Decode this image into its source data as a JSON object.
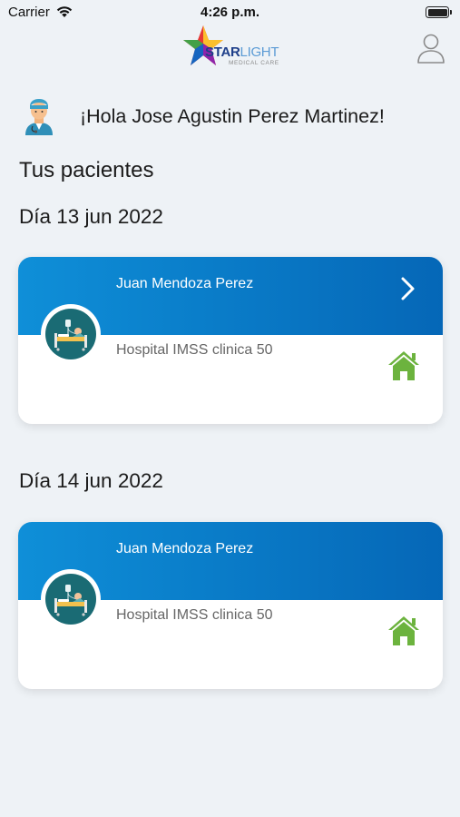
{
  "status_bar": {
    "carrier": "Carrier",
    "time": "4:26 p.m."
  },
  "header": {
    "logo": {
      "star": "STAR",
      "light": "LIGHT",
      "subtitle": "MEDICAL CARE"
    },
    "profile_icon": "person-outline-icon"
  },
  "greeting": {
    "text": "¡Hola Jose Agustin Perez Martinez!",
    "avatar_icon": "doctor-avatar-icon"
  },
  "section_title": "Tus pacientes",
  "days": [
    {
      "label": "Día 13 jun 2022",
      "card": {
        "patient_name": "Juan Mendoza Perez",
        "hospital": "Hospital IMSS clinica 50",
        "has_chevron": true,
        "home_icon": "home-icon"
      }
    },
    {
      "label": "Día 14 jun 2022",
      "card": {
        "patient_name": "Juan Mendoza Perez",
        "hospital": "Hospital IMSS clinica 50",
        "has_chevron": false,
        "home_icon": "home-icon"
      }
    }
  ],
  "colors": {
    "background": "#eef2f6",
    "card_band_start": "#0f8fd8",
    "card_band_end": "#0567b7",
    "home_icon": "#6cb33e",
    "avatar_bg": "#1a6b74"
  }
}
